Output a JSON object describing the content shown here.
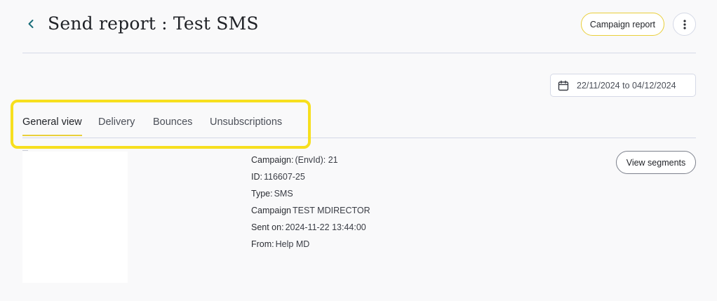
{
  "header": {
    "title": "Send report : Test SMS",
    "campaign_report_label": "Campaign report"
  },
  "date_range": {
    "value": "22/11/2024 to 04/12/2024"
  },
  "tabs": [
    {
      "label": "General view",
      "active": true
    },
    {
      "label": "Delivery",
      "active": false
    },
    {
      "label": "Bounces",
      "active": false
    },
    {
      "label": "Unsubscriptions",
      "active": false
    }
  ],
  "info": {
    "rows": [
      {
        "label": "Campaign:",
        "value": "(EnvId): 21"
      },
      {
        "label": "ID:",
        "value": "116607-25"
      },
      {
        "label": "Type:",
        "value": "SMS"
      },
      {
        "label": "Campaign",
        "value": "TEST MDIRECTOR"
      },
      {
        "label": "Sent on:",
        "value": "2024-11-22 13:44:00"
      },
      {
        "label": "From:",
        "value": "Help MD"
      }
    ]
  },
  "view_segments_label": "View segments",
  "colors": {
    "accent": "#e9cf3a",
    "highlight": "#f7df1e",
    "back_arrow": "#1a6e7a",
    "divider": "#d5d9e6"
  },
  "icons": {
    "back": "chevron-left-icon",
    "more": "vertical-dots-icon",
    "calendar": "calendar-icon"
  }
}
